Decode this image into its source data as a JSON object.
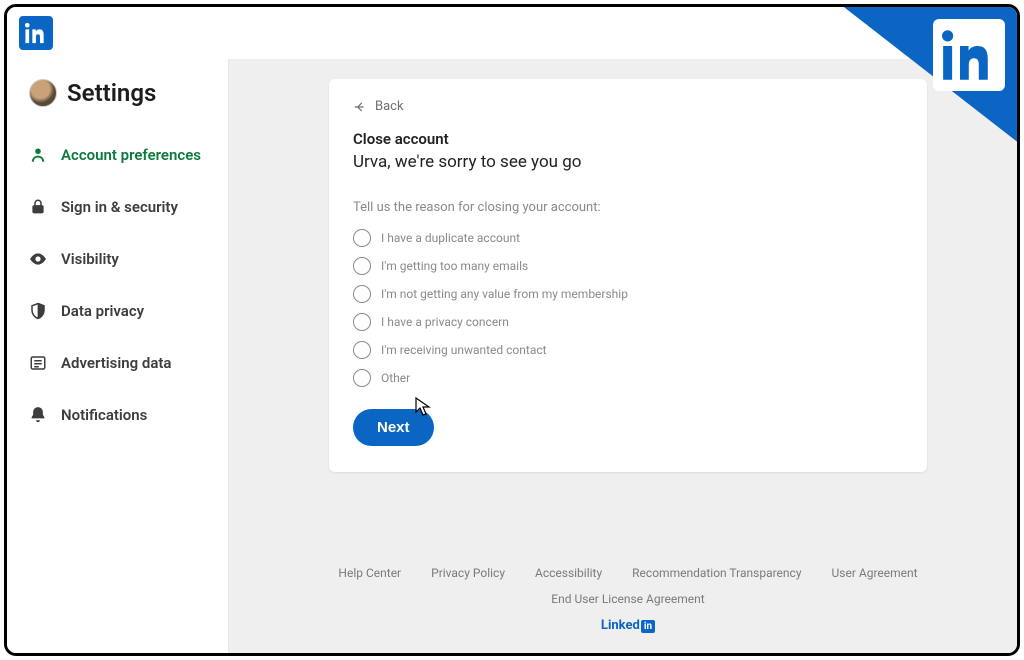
{
  "sidebar": {
    "title": "Settings",
    "items": [
      {
        "label": "Account preferences",
        "icon": "person-icon",
        "active": true
      },
      {
        "label": "Sign in & security",
        "icon": "lock-icon",
        "active": false
      },
      {
        "label": "Visibility",
        "icon": "eye-icon",
        "active": false
      },
      {
        "label": "Data privacy",
        "icon": "shield-icon",
        "active": false
      },
      {
        "label": "Advertising data",
        "icon": "newspaper-icon",
        "active": false
      },
      {
        "label": "Notifications",
        "icon": "bell-icon",
        "active": false
      }
    ]
  },
  "panel": {
    "back_label": "Back",
    "title": "Close account",
    "subtitle": "Urva, we're sorry to see you go",
    "prompt": "Tell us the reason for closing your account:",
    "options": [
      "I have a duplicate account",
      "I'm getting too many emails",
      "I'm not getting any value from my membership",
      "I have a privacy concern",
      "I'm receiving unwanted contact",
      "Other"
    ],
    "next_label": "Next"
  },
  "footer": {
    "links_row1": [
      "Help Center",
      "Privacy Policy",
      "Accessibility",
      "Recommendation Transparency",
      "User Agreement"
    ],
    "links_row2": [
      "End User License Agreement"
    ],
    "brand": "Linked"
  }
}
